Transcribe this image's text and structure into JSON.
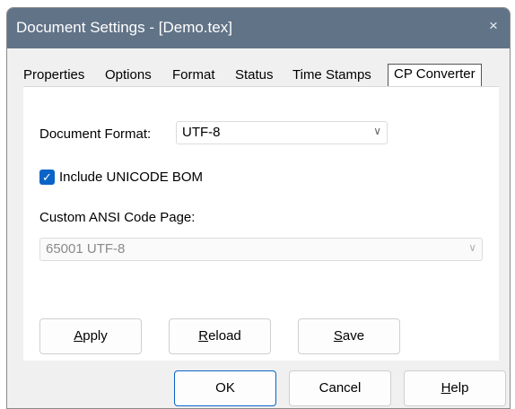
{
  "window": {
    "title": "Document Settings - [Demo.tex]",
    "close_glyph": "×"
  },
  "tabs": [
    {
      "label": "Properties"
    },
    {
      "label": "Options"
    },
    {
      "label": "Format"
    },
    {
      "label": "Status"
    },
    {
      "label": "Time Stamps"
    },
    {
      "label": "CP Converter",
      "active": true
    }
  ],
  "panel": {
    "document_format_label": "Document Format:",
    "document_format_value": "UTF-8",
    "include_bom_label": "Include UNICODE BOM",
    "include_bom_checked": true,
    "custom_codepage_label": "Custom ANSI Code Page:",
    "custom_codepage_value": "65001 UTF-8",
    "apply_label": {
      "pre": "",
      "acc": "A",
      "post": "pply"
    },
    "reload_label": {
      "pre": "",
      "acc": "R",
      "post": "eload"
    },
    "save_label": {
      "pre": "",
      "acc": "S",
      "post": "ave"
    }
  },
  "footer": {
    "ok_label": "OK",
    "cancel_label": "Cancel",
    "help_label": {
      "pre": "",
      "acc": "H",
      "post": "elp"
    }
  },
  "icons": {
    "chevron": "chevron-down-icon",
    "check": "checkmark-icon",
    "close": "close-icon"
  },
  "colors": {
    "titlebar": "#617387",
    "accent": "#0a64c8"
  }
}
